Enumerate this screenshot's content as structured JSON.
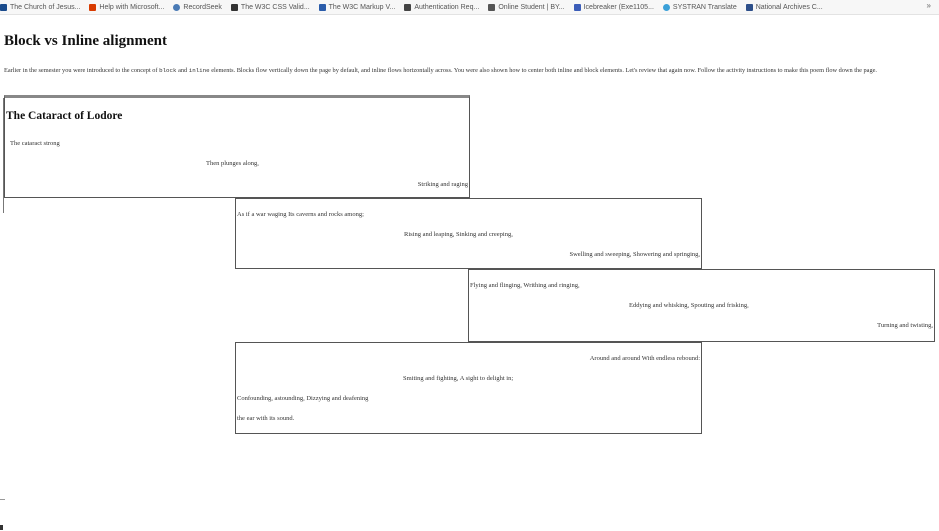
{
  "bookmarks": [
    {
      "label": "The Church of Jesus...",
      "icon": "church-icon",
      "color": "#1a4b8c"
    },
    {
      "label": "Help with Microsoft...",
      "icon": "office-icon",
      "color": "#d83b01"
    },
    {
      "label": "RecordSeek",
      "icon": "globe-icon",
      "color": "#4a7ab5"
    },
    {
      "label": "The W3C CSS Valid...",
      "icon": "w3c-icon",
      "color": "#333333"
    },
    {
      "label": "The W3C Markup V...",
      "icon": "w3c-markup-icon",
      "color": "#2a5caa"
    },
    {
      "label": "Authentication Req...",
      "icon": "page-icon",
      "color": "#444444"
    },
    {
      "label": "Online Student | BY...",
      "icon": "page-icon",
      "color": "#555555"
    },
    {
      "label": "Icebreaker (Exe1105...",
      "icon": "icebreaker-icon",
      "color": "#3b5db8"
    },
    {
      "label": "SYSTRAN Translate",
      "icon": "systran-icon",
      "color": "#3aa0d8"
    },
    {
      "label": "National Archives C...",
      "icon": "archives-icon",
      "color": "#2d4f8a"
    }
  ],
  "more_symbol": "»",
  "page": {
    "title": "Block vs Inline alignment",
    "intro_before_block": "Earlier in the semester you were introduced to the concept of ",
    "code_block": "block",
    "intro_and": " and ",
    "code_inline": "inline",
    "intro_after": " elements. Blocks flow vertically down the page by default, and inline flows horizontally across. You were also shown how to center both inline and block elements. Let's review that again now. Follow the activity instructions to make this poem flow down the page."
  },
  "poem": {
    "title": "The Cataract of Lodore",
    "box1": [
      "The cataract strong",
      "Then plunges along,",
      "Striking and raging"
    ],
    "box2": [
      "As if a war waging Its caverns and rocks among;",
      "Rising and leaping, Sinking and creeping,",
      "Swelling and sweeping, Showering and springing,"
    ],
    "box3": [
      "Flying and flinging, Writhing and ringing,",
      "Eddying and whisking, Spouting and frisking,",
      "Turning and twisting,"
    ],
    "box4": [
      "Around and around With endless rebound:",
      "Smiting and fighting, A sight to delight in;",
      "Confounding, astounding, Dizzying and deafening",
      "the ear with its sound."
    ]
  }
}
